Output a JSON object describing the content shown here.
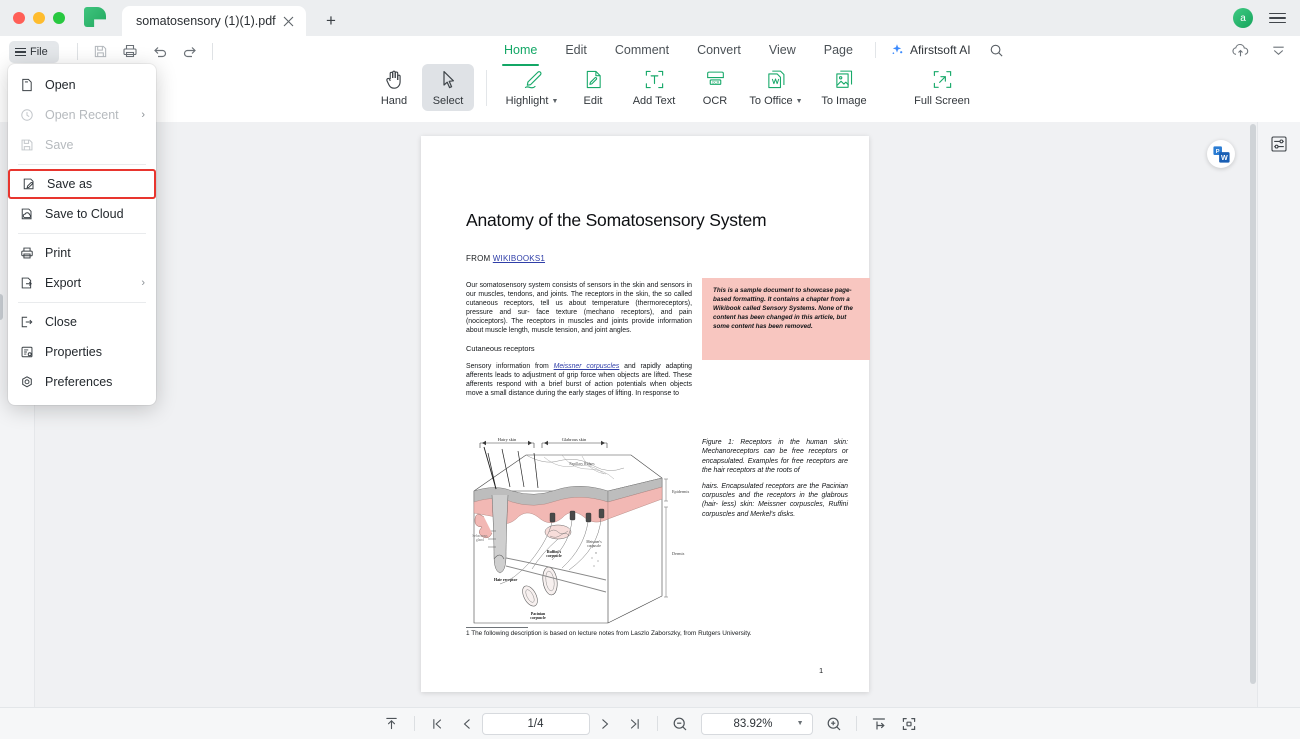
{
  "window": {
    "tab_title": "somatosensory (1)(1).pdf",
    "new_tab_label": "+",
    "avatar_initial": "a"
  },
  "toolbar": {
    "file_label": "File",
    "quick_icons": [
      "save-icon",
      "print-icon",
      "undo-icon",
      "redo-icon"
    ]
  },
  "nav": {
    "tabs": [
      {
        "label": "Home",
        "active": true
      },
      {
        "label": "Edit",
        "active": false
      },
      {
        "label": "Comment",
        "active": false
      },
      {
        "label": "Convert",
        "active": false
      },
      {
        "label": "View",
        "active": false
      },
      {
        "label": "Page",
        "active": false
      }
    ],
    "ai_label": "Afirstsoft AI"
  },
  "tools": [
    {
      "label": "Hand",
      "icon": "hand-icon",
      "active": false,
      "caret": false
    },
    {
      "label": "Select",
      "icon": "cursor-icon",
      "active": true,
      "caret": false
    },
    {
      "label": "Highlight",
      "icon": "highlight-pen-icon",
      "active": false,
      "caret": true
    },
    {
      "label": "Edit",
      "icon": "edit-document-icon",
      "active": false,
      "caret": false
    },
    {
      "label": "Add Text",
      "icon": "add-text-icon",
      "active": false,
      "caret": false
    },
    {
      "label": "OCR",
      "icon": "ocr-icon",
      "active": false,
      "caret": false
    },
    {
      "label": "To Office",
      "icon": "to-office-icon",
      "active": false,
      "caret": true
    },
    {
      "label": "To Image",
      "icon": "to-image-icon",
      "active": false,
      "caret": false
    },
    {
      "label": "Full Screen",
      "icon": "full-screen-icon",
      "active": false,
      "caret": false
    }
  ],
  "file_menu": {
    "items": [
      {
        "label": "Open",
        "icon": "open-file-icon",
        "disabled": false,
        "submenu": false,
        "selected": false
      },
      {
        "label": "Open Recent",
        "icon": "clock-icon",
        "disabled": true,
        "submenu": true,
        "selected": false
      },
      {
        "label": "Save",
        "icon": "floppy-icon",
        "disabled": true,
        "submenu": false,
        "selected": false
      },
      {
        "label": "Save as",
        "icon": "save-as-icon",
        "disabled": false,
        "submenu": false,
        "selected": true
      },
      {
        "label": "Save to Cloud",
        "icon": "save-cloud-icon",
        "disabled": false,
        "submenu": false,
        "selected": false
      },
      {
        "label": "Print",
        "icon": "printer-icon",
        "disabled": false,
        "submenu": false,
        "selected": false
      },
      {
        "label": "Export",
        "icon": "export-icon",
        "disabled": false,
        "submenu": true,
        "selected": false
      },
      {
        "label": "Close",
        "icon": "close-door-icon",
        "disabled": false,
        "submenu": false,
        "selected": false
      },
      {
        "label": "Properties",
        "icon": "properties-icon",
        "disabled": false,
        "submenu": false,
        "selected": false
      },
      {
        "label": "Preferences",
        "icon": "preferences-icon",
        "disabled": false,
        "submenu": false,
        "selected": false
      }
    ],
    "highlight_color": "#e8352e"
  },
  "document": {
    "title": "Anatomy of the Somatosensory System",
    "from_prefix": "FROM ",
    "from_link": "WIKIBOOKS1",
    "paragraph_1": "Our somatosensory system consists of sensors in the skin and sensors in our muscles, tendons, and joints. The receptors in the skin, the so called cutaneous receptors, tell us about temperature (thermoreceptors), pressure and sur- face texture (mechano receptors), and pain (nociceptors). The receptors in muscles and joints provide information about muscle length, muscle tension, and joint angles.",
    "subheading": "Cutaneous receptors",
    "paragraph_2_pre": "Sensory information from ",
    "paragraph_2_link": "Meissner corpuscles",
    "paragraph_2_post": " and rapidly adapting afferents leads to adjustment of grip force when objects are lifted. These afferents respond with a brief burst of action potentials when objects move a small distance during the early stages of lifting. In response to",
    "callout": "This is a sample document to showcase page-based formatting. It contains a chapter from a Wikibook called Sensory Systems. None of the content has been changed in this article, but some content has been removed.",
    "figure_caption_1": "Figure 1: Receptors in the human skin: Mechanoreceptors can be free receptors or encapsulated. Examples for free receptors are the hair receptors at the roots of",
    "figure_caption_2": "hairs. Encapsulated receptors are the Pacinian corpuscles and the receptors in the glabrous (hair- less) skin: Meissner corpuscles, Ruffini corpuscles and Merkel's disks.",
    "footnote": "1 The following description is based on lecture notes from Laszlo Zaborszky, from Rutgers University.",
    "page_number": "1",
    "figure_labels": {
      "hairy_skin": "Hairy skin",
      "glabrous_skin": "Glabrous skin",
      "papillary_ridges": "Papillary Ridges",
      "epidermis": "Epidermis",
      "dermis": "Dermis",
      "sebaceous_gland": "Sebaceous gland",
      "hair_receptor": "Hair receptor",
      "ruffini": "Ruffini's corpuscle",
      "meissner": "Meissner's corpuscle",
      "pacinian": "Pacinian corpuscle"
    }
  },
  "statusbar": {
    "page_value": "1/4",
    "zoom_value": "83.92%",
    "icons": [
      "scroll-top-icon",
      "first-page-icon",
      "prev-page-icon",
      "next-page-icon",
      "last-page-icon",
      "zoom-out-icon",
      "zoom-in-icon",
      "fit-width-icon",
      "fit-page-icon"
    ]
  },
  "colors": {
    "accent_green": "#13a766",
    "highlight_red": "#e8352e",
    "canvas_bg": "#f0f1f3",
    "callout_pink": "#f8c6c0"
  }
}
